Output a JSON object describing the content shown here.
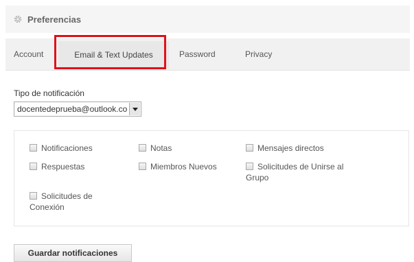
{
  "header": {
    "title": "Preferencias",
    "icon": "gear-icon"
  },
  "tabs": [
    {
      "label": "Account",
      "active": false
    },
    {
      "label": "Email & Text Updates",
      "active": true
    },
    {
      "label": "Password",
      "active": false
    },
    {
      "label": "Privacy",
      "active": false
    }
  ],
  "highlight_color": "#e0101a",
  "notification": {
    "label": "Tipo de notificación",
    "selected": "docentedeprueba@outlook.com"
  },
  "options": [
    {
      "label": "Notificaciones",
      "checked": false
    },
    {
      "label": "Notas",
      "checked": false
    },
    {
      "label": "Mensajes directos",
      "checked": false
    },
    {
      "label": "Respuestas",
      "checked": false
    },
    {
      "label": "Miembros Nuevos",
      "checked": false
    },
    {
      "label": "Solicitudes de Unirse al",
      "label_line2": "Grupo",
      "checked": false
    },
    {
      "label": "Solicitudes de",
      "label_line2": "Conexión",
      "checked": false
    }
  ],
  "save_button": {
    "label": "Guardar notificaciones"
  }
}
